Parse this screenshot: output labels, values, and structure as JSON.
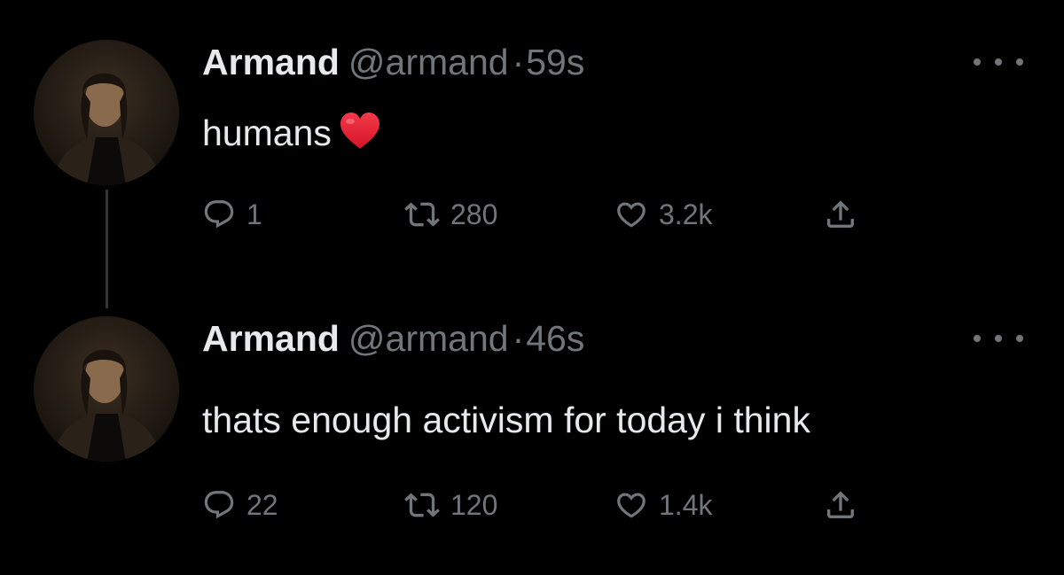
{
  "colors": {
    "background": "#000000",
    "primary_text": "#e7e9ea",
    "secondary_text": "#71767b",
    "thread_line": "#333639",
    "heart_emoji": "#e0192d"
  },
  "tweets": [
    {
      "display_name": "Armand",
      "handle": "@armand",
      "separator": "·",
      "time": "59s",
      "text": "humans",
      "emoji": "red-heart",
      "more_icon": "ellipsis-icon",
      "actions": {
        "replies": "1",
        "retweets": "280",
        "likes": "3.2k",
        "share_icon": "share-icon"
      }
    },
    {
      "display_name": "Armand",
      "handle": "@armand",
      "separator": "·",
      "time": "46s",
      "text": "thats enough activism for today i think",
      "more_icon": "ellipsis-icon",
      "actions": {
        "replies": "22",
        "retweets": "120",
        "likes": "1.4k",
        "share_icon": "share-icon"
      }
    }
  ]
}
